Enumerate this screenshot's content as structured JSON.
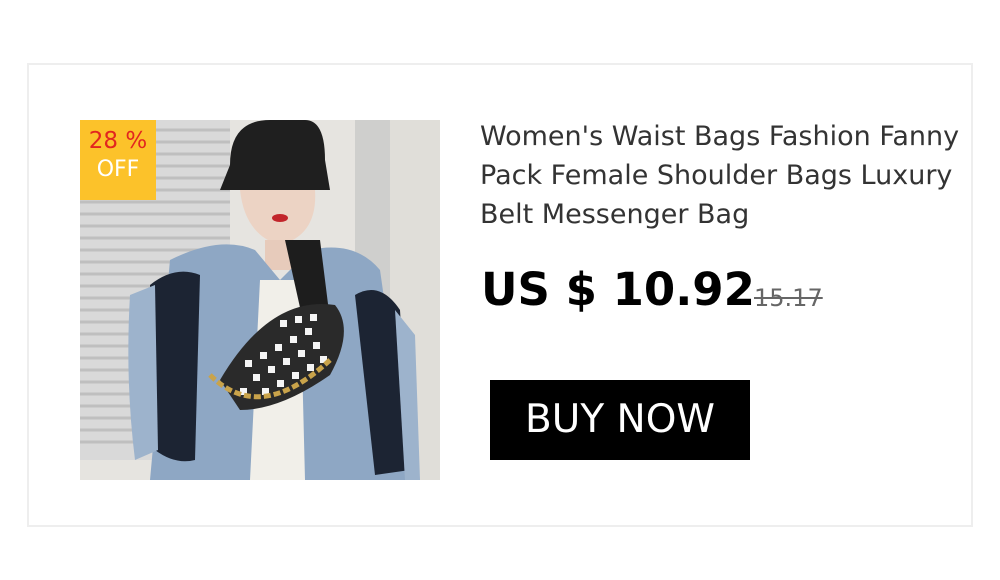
{
  "product": {
    "title": "Women's Waist Bags Fashion Fanny Pack Female Shoulder Bags Luxury Belt Messenger Bag",
    "price": "US $ 10.92",
    "original_price": "15.17",
    "image_icon": "product-photo"
  },
  "badge": {
    "percent": "28 %",
    "off": "OFF"
  },
  "cta": {
    "label": "BUY NOW"
  },
  "colors": {
    "badge_bg": "#fcc22a",
    "badge_percent": "#e2261f",
    "button_bg": "#000000",
    "button_text": "#ffffff"
  }
}
